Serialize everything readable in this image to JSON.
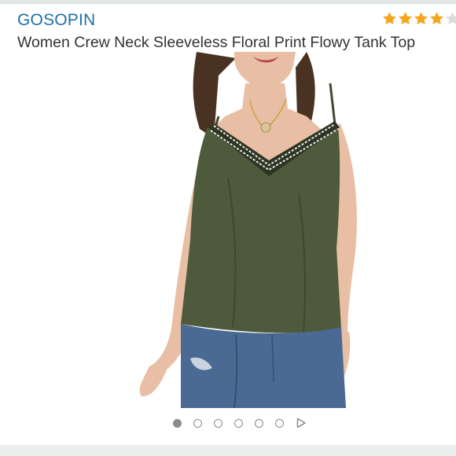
{
  "product": {
    "brand": "GOSOPIN",
    "title": "Women Crew Neck Sleeveless Floral Print Flowy Tank Top",
    "rating": 4,
    "rating_max": 5
  },
  "carousel": {
    "count": 6,
    "active_index": 0,
    "next_icon": "next-arrow-icon"
  },
  "colors": {
    "brand": "#1f6fa8",
    "star": "#f6a41b",
    "star_empty": "#dcdcdc",
    "tank_top": "#4e5a3c",
    "jeans": "#4a6a93"
  }
}
